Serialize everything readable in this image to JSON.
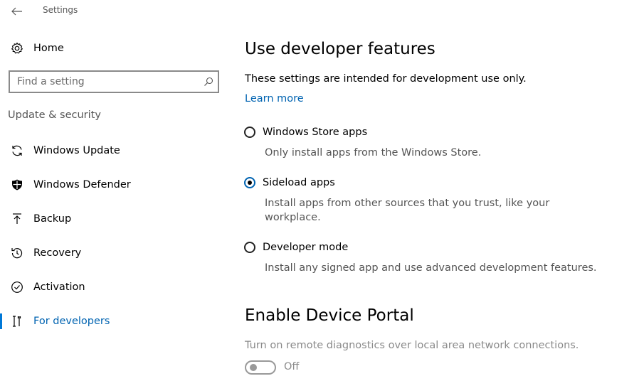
{
  "window": {
    "title": "Settings"
  },
  "sidebar": {
    "home_label": "Home",
    "search_placeholder": "Find a setting",
    "section_label": "Update & security",
    "items": [
      {
        "label": "Windows Update",
        "icon": "sync-icon",
        "active": false
      },
      {
        "label": "Windows Defender",
        "icon": "shield-icon",
        "active": false
      },
      {
        "label": "Backup",
        "icon": "backup-arrow-icon",
        "active": false
      },
      {
        "label": "Recovery",
        "icon": "recovery-icon",
        "active": false
      },
      {
        "label": "Activation",
        "icon": "checkmark-circle-icon",
        "active": false
      },
      {
        "label": "For developers",
        "icon": "developer-tools-icon",
        "active": true
      }
    ]
  },
  "main": {
    "dev_features": {
      "title": "Use developer features",
      "intro": "These settings are intended for development use only.",
      "learn_more": "Learn more",
      "options": [
        {
          "label": "Windows Store apps",
          "description": "Only install apps from the Windows Store.",
          "selected": false
        },
        {
          "label": "Sideload apps",
          "description_line1": "Install apps from other sources that you trust, like your",
          "description_line2": "workplace.",
          "selected": true
        },
        {
          "label": "Developer mode",
          "description": "Install any signed app and use advanced development features.",
          "selected": false
        }
      ]
    },
    "device_portal": {
      "title": "Enable Device Portal",
      "description": "Turn on remote diagnostics over local area network connections.",
      "toggle_state": "Off",
      "enabled": false
    }
  },
  "colors": {
    "accent": "#0078d7",
    "link": "#0063b1",
    "disabled": "#8a8a8a"
  }
}
